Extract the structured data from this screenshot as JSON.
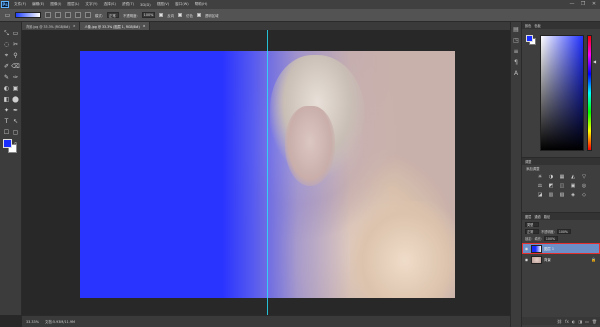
{
  "menubar": {
    "logo": "Ps",
    "items": [
      "文件(F)",
      "编辑(E)",
      "图像(I)",
      "图层(L)",
      "文字(Y)",
      "选择(S)",
      "滤镜(T)",
      "3D(D)",
      "视图(V)",
      "窗口(W)",
      "帮助(H)"
    ],
    "window_controls": [
      "—",
      "❐",
      "✕"
    ]
  },
  "options": {
    "mode_label": "模式:",
    "mode_value": "正常",
    "opacity_label": "不透明度:",
    "opacity_value": "100%",
    "reverse_label": "反向",
    "dither_label": "仿色",
    "transparency_label": "透明区域"
  },
  "doctabs": [
    {
      "label": "背景.jpg @ 33.3% (RGB/8#)",
      "active": false
    },
    {
      "label": "人像.jpg @ 33.3% (图层 1, RGB/8#)",
      "active": true
    }
  ],
  "toolbar": {
    "col1": [
      "⤡",
      "◌",
      "⌖",
      "✐",
      "✎",
      "◐",
      "◧",
      "✦",
      "T",
      "☐",
      "✋"
    ],
    "col2": [
      "▭",
      "✂",
      "⚲",
      "⌫",
      "✑",
      "▣",
      "⬤",
      "✒",
      "↖",
      "▢",
      "⌕"
    ]
  },
  "statusbar": {
    "zoom": "33.33%",
    "doc_info": "文档:5.93M/11.9M"
  },
  "iconstrip": [
    "▤",
    "◳",
    "≡",
    "¶",
    "A"
  ],
  "panels": {
    "color_tabs": [
      "颜色",
      "色板"
    ],
    "adjust_tab": "调整",
    "adjust_title": "添加调整",
    "adjust_icons": [
      "☀",
      "◑",
      "▦",
      "◭",
      "▽",
      "⚖",
      "◩",
      "◫",
      "▣",
      "◎",
      "◪",
      "▥",
      "▧",
      "◈",
      "◇"
    ],
    "layers_tabs": [
      "图层",
      "通道",
      "路径"
    ],
    "layer_kind": "类型",
    "blend_mode": "正常",
    "opacity_label": "不透明度:",
    "opacity_value": "100%",
    "lock_label": "锁定:",
    "fill_label": "填充:",
    "fill_value": "100%",
    "layers": [
      {
        "name": "图层 1",
        "selected": true
      },
      {
        "name": "背景",
        "selected": false
      }
    ],
    "footer_icons": [
      "⛓",
      "fx",
      "◐",
      "◨",
      "▭",
      "🗑"
    ]
  }
}
